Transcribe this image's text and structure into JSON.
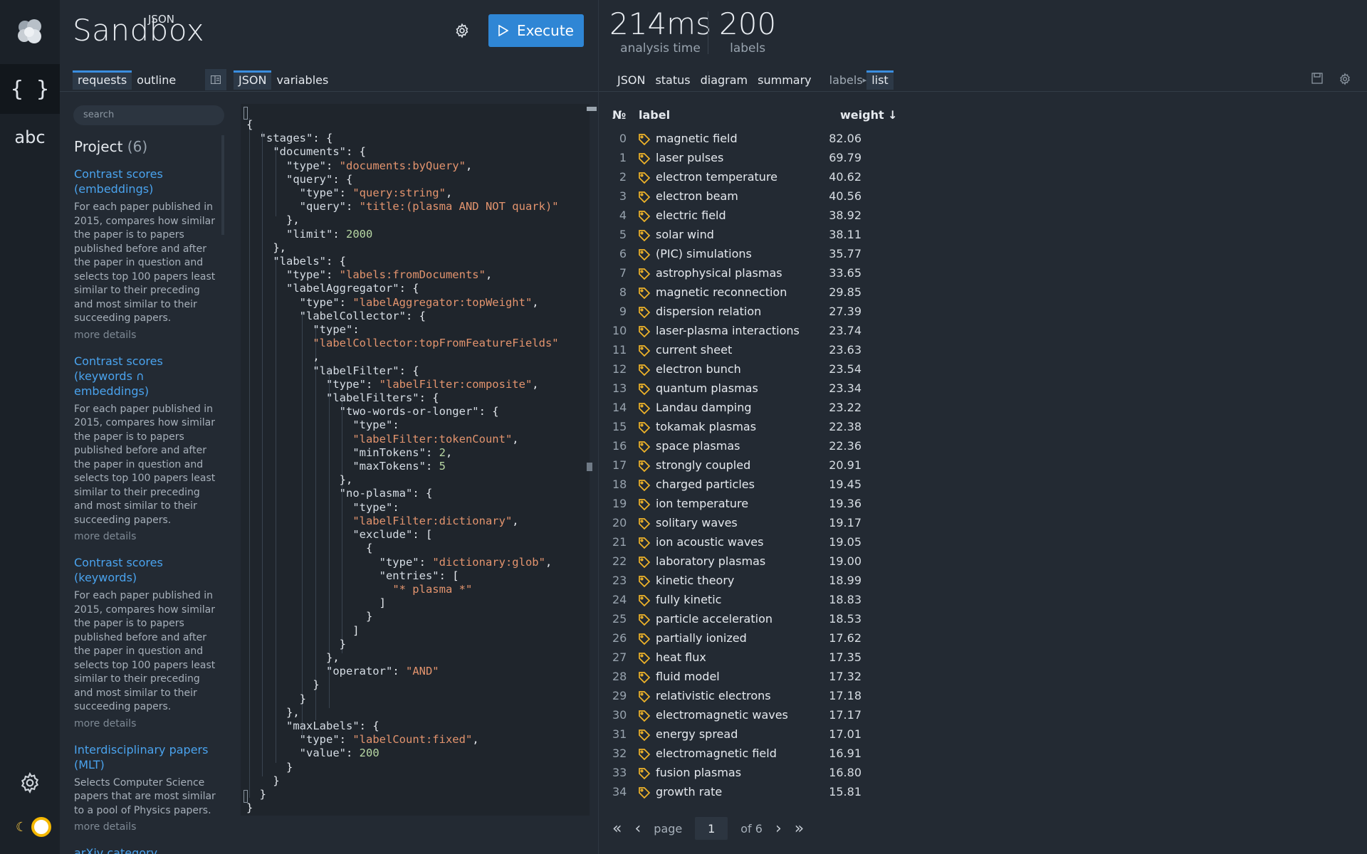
{
  "app": {
    "brand_small": "JSON",
    "brand": "Sandbox",
    "execute_label": "Execute",
    "rail_json": "{ }",
    "rail_abc": "abc"
  },
  "stats": {
    "time_value": "214ms",
    "time_label": "analysis time",
    "labels_value": "200",
    "labels_label": "labels"
  },
  "left_tabs": [
    "requests",
    "outline"
  ],
  "mid_tabs": [
    "JSON",
    "variables"
  ],
  "right_tabs": [
    "JSON",
    "status",
    "diagram",
    "summary"
  ],
  "right_subtabs": {
    "labels": "labels",
    "sep": "▸",
    "list": "list"
  },
  "search": {
    "placeholder": "search"
  },
  "project": {
    "title": "Project",
    "count": "(6)",
    "items": [
      {
        "name": "Contrast scores (embeddings)",
        "desc": "For each paper published in 2015, compares how similar the paper is to papers published before and after the paper in question and selects top 100 papers least similar to their preceding and most similar to their succeeding papers.",
        "more": "more details"
      },
      {
        "name": "Contrast scores (keywords ∩ embeddings)",
        "desc": "For each paper published in 2015, compares how similar the paper is to papers published before and after the paper in question and selects top 100 papers least similar to their preceding and most similar to their succeeding papers.",
        "more": "more details"
      },
      {
        "name": "Contrast scores (keywords)",
        "desc": "For each paper published in 2015, compares how similar the paper is to papers published before and after the paper in question and selects top 100 papers least similar to their preceding and most similar to their succeeding papers.",
        "more": "more details"
      },
      {
        "name": "Interdisciplinary papers (MLT)",
        "desc": "Selects Computer Science papers that are most similar to a pool of Physics papers.",
        "more": "more details"
      },
      {
        "name": "arXiv category suggestions",
        "desc": "",
        "more": ""
      }
    ]
  },
  "code_lines": [
    "{",
    "  \"stages\": {",
    "    \"documents\": {",
    "      \"type\": \"documents:byQuery\",",
    "      \"query\": {",
    "        \"type\": \"query:string\",",
    "        \"query\": \"title:(plasma AND NOT quark)\"",
    "      },",
    "      \"limit\": 2000",
    "    },",
    "    \"labels\": {",
    "      \"type\": \"labels:fromDocuments\",",
    "      \"labelAggregator\": {",
    "        \"type\": \"labelAggregator:topWeight\",",
    "        \"labelCollector\": {",
    "          \"type\":",
    "          \"labelCollector:topFromFeatureFields\"",
    "          ,",
    "          \"labelFilter\": {",
    "            \"type\": \"labelFilter:composite\",",
    "            \"labelFilters\": {",
    "              \"two-words-or-longer\": {",
    "                \"type\":",
    "                \"labelFilter:tokenCount\",",
    "                \"minTokens\": 2,",
    "                \"maxTokens\": 5",
    "              },",
    "              \"no-plasma\": {",
    "                \"type\":",
    "                \"labelFilter:dictionary\",",
    "                \"exclude\": [",
    "                  {",
    "                    \"type\": \"dictionary:glob\",",
    "                    \"entries\": [",
    "                      \"* plasma *\"",
    "                    ]",
    "                  }",
    "                ]",
    "              }",
    "            },",
    "            \"operator\": \"AND\"",
    "          }",
    "        }",
    "      },",
    "      \"maxLabels\": {",
    "        \"type\": \"labelCount:fixed\",",
    "        \"value\": 200",
    "      }",
    "    }",
    "  }",
    "}"
  ],
  "results": {
    "col_no": "№",
    "col_label": "label",
    "col_weight": "weight ↓",
    "rows": [
      {
        "i": "0",
        "label": "magnetic field",
        "w": "82.06"
      },
      {
        "i": "1",
        "label": "laser pulses",
        "w": "69.79"
      },
      {
        "i": "2",
        "label": "electron temperature",
        "w": "40.62"
      },
      {
        "i": "3",
        "label": "electron beam",
        "w": "40.56"
      },
      {
        "i": "4",
        "label": "electric field",
        "w": "38.92"
      },
      {
        "i": "5",
        "label": "solar wind",
        "w": "38.11"
      },
      {
        "i": "6",
        "label": "(PIC) simulations",
        "w": "35.77"
      },
      {
        "i": "7",
        "label": "astrophysical plasmas",
        "w": "33.65"
      },
      {
        "i": "8",
        "label": "magnetic reconnection",
        "w": "29.85"
      },
      {
        "i": "9",
        "label": "dispersion relation",
        "w": "27.39"
      },
      {
        "i": "10",
        "label": "laser-plasma interactions",
        "w": "23.74"
      },
      {
        "i": "11",
        "label": "current sheet",
        "w": "23.63"
      },
      {
        "i": "12",
        "label": "electron bunch",
        "w": "23.54"
      },
      {
        "i": "13",
        "label": "quantum plasmas",
        "w": "23.34"
      },
      {
        "i": "14",
        "label": "Landau damping",
        "w": "23.22"
      },
      {
        "i": "15",
        "label": "tokamak plasmas",
        "w": "22.38"
      },
      {
        "i": "16",
        "label": "space plasmas",
        "w": "22.36"
      },
      {
        "i": "17",
        "label": "strongly coupled",
        "w": "20.91"
      },
      {
        "i": "18",
        "label": "charged particles",
        "w": "19.45"
      },
      {
        "i": "19",
        "label": "ion temperature",
        "w": "19.36"
      },
      {
        "i": "20",
        "label": "solitary waves",
        "w": "19.17"
      },
      {
        "i": "21",
        "label": "ion acoustic waves",
        "w": "19.05"
      },
      {
        "i": "22",
        "label": "laboratory plasmas",
        "w": "19.00"
      },
      {
        "i": "23",
        "label": "kinetic theory",
        "w": "18.99"
      },
      {
        "i": "24",
        "label": "fully kinetic",
        "w": "18.83"
      },
      {
        "i": "25",
        "label": "particle acceleration",
        "w": "18.53"
      },
      {
        "i": "26",
        "label": "partially ionized",
        "w": "17.62"
      },
      {
        "i": "27",
        "label": "heat flux",
        "w": "17.35"
      },
      {
        "i": "28",
        "label": "fluid model",
        "w": "17.32"
      },
      {
        "i": "29",
        "label": "relativistic electrons",
        "w": "17.18"
      },
      {
        "i": "30",
        "label": "electromagnetic waves",
        "w": "17.17"
      },
      {
        "i": "31",
        "label": "energy spread",
        "w": "17.01"
      },
      {
        "i": "32",
        "label": "electromagnetic field",
        "w": "16.91"
      },
      {
        "i": "33",
        "label": "fusion plasmas",
        "w": "16.80"
      },
      {
        "i": "34",
        "label": "growth rate",
        "w": "15.81"
      }
    ]
  },
  "pager": {
    "page_label": "page",
    "page": "1",
    "of_label": "of 6"
  },
  "colors": {
    "accent": "#2f86d5",
    "link": "#4aa3ee",
    "tag": "#f0b429",
    "string": "#e3946e",
    "number": "#b8d8a4"
  },
  "icons": {
    "logo": "cloud-logo-icon",
    "gear": "gear-icon",
    "play": "play-icon",
    "tag": "tag-icon",
    "save": "save-icon",
    "moon": "moon-icon"
  }
}
